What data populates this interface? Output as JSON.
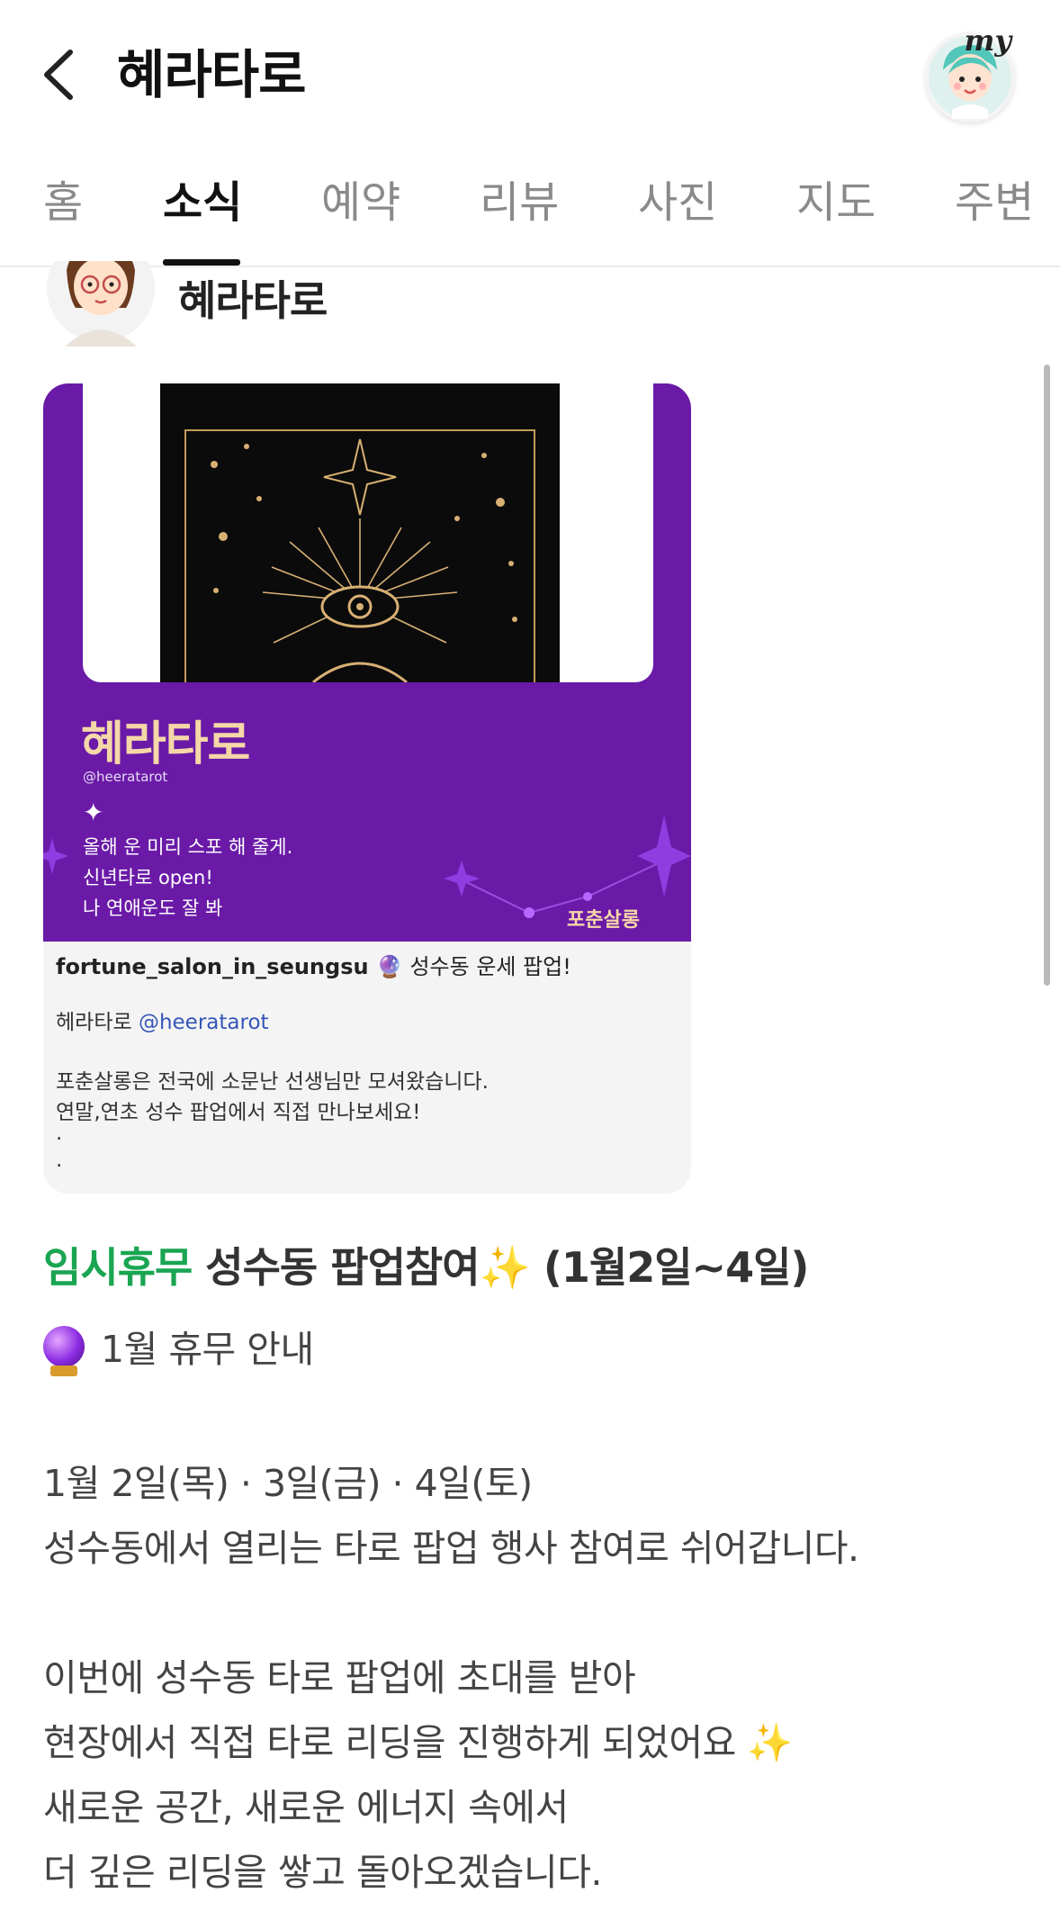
{
  "header": {
    "title": "혜라타로",
    "my_label": "my"
  },
  "tabs": [
    {
      "label": "홈"
    },
    {
      "label": "소식"
    },
    {
      "label": "예약"
    },
    {
      "label": "리뷰"
    },
    {
      "label": "사진"
    },
    {
      "label": "지도"
    },
    {
      "label": "주변"
    }
  ],
  "active_tab": "소식",
  "author": {
    "name": "혜라타로"
  },
  "post_image": {
    "poster_title": "혜라타로",
    "poster_handle": "@heeratarot",
    "poster_spark": "✦",
    "poster_lines": [
      "올해 운 미리 스포 해 줄게.",
      "신년타로 open!",
      "나 연애운도 잘 봐"
    ],
    "poster_brand": "포춘살롱",
    "caption_user": "fortune_salon_in_seungsu",
    "caption_user_suffix": "🔮 성수동 운세 팝업!",
    "caption_name": "헤라타로",
    "caption_link": "@heeratarot",
    "caption_line1": "포춘살롱은 전국에 소문난 선생님만 모셔왔습니다.",
    "caption_line2": "연말,연초 성수 팝업에서 직접 만나보세요!",
    "caption_dot1": ".",
    "caption_dot2": "."
  },
  "post": {
    "badge": "임시휴무",
    "headline": "성수동 팝업참여",
    "headline_sparkle": "✨",
    "headline_dates": "(1월2일~4일)",
    "notice": "1월 휴무 안내",
    "lines": [
      "1월 2일(목) · 3일(금) · 4일(토)",
      "성수동에서 열리는 타로 팝업 행사 참여로 쉬어갑니다.",
      "이번에 성수동 타로 팝업에 초대를 받아",
      "현장에서 직접 타로 리딩을 진행하게 되었어요",
      "새로운 공간, 새로운 에너지 속에서",
      "더 깊은 리딩을 쌓고 돌아오겠습니다."
    ],
    "line_sparkle": "✨"
  },
  "colors": {
    "badge_green": "#1aa552",
    "poster_purple": "#6a1aa7",
    "link_blue": "#3556b8"
  }
}
